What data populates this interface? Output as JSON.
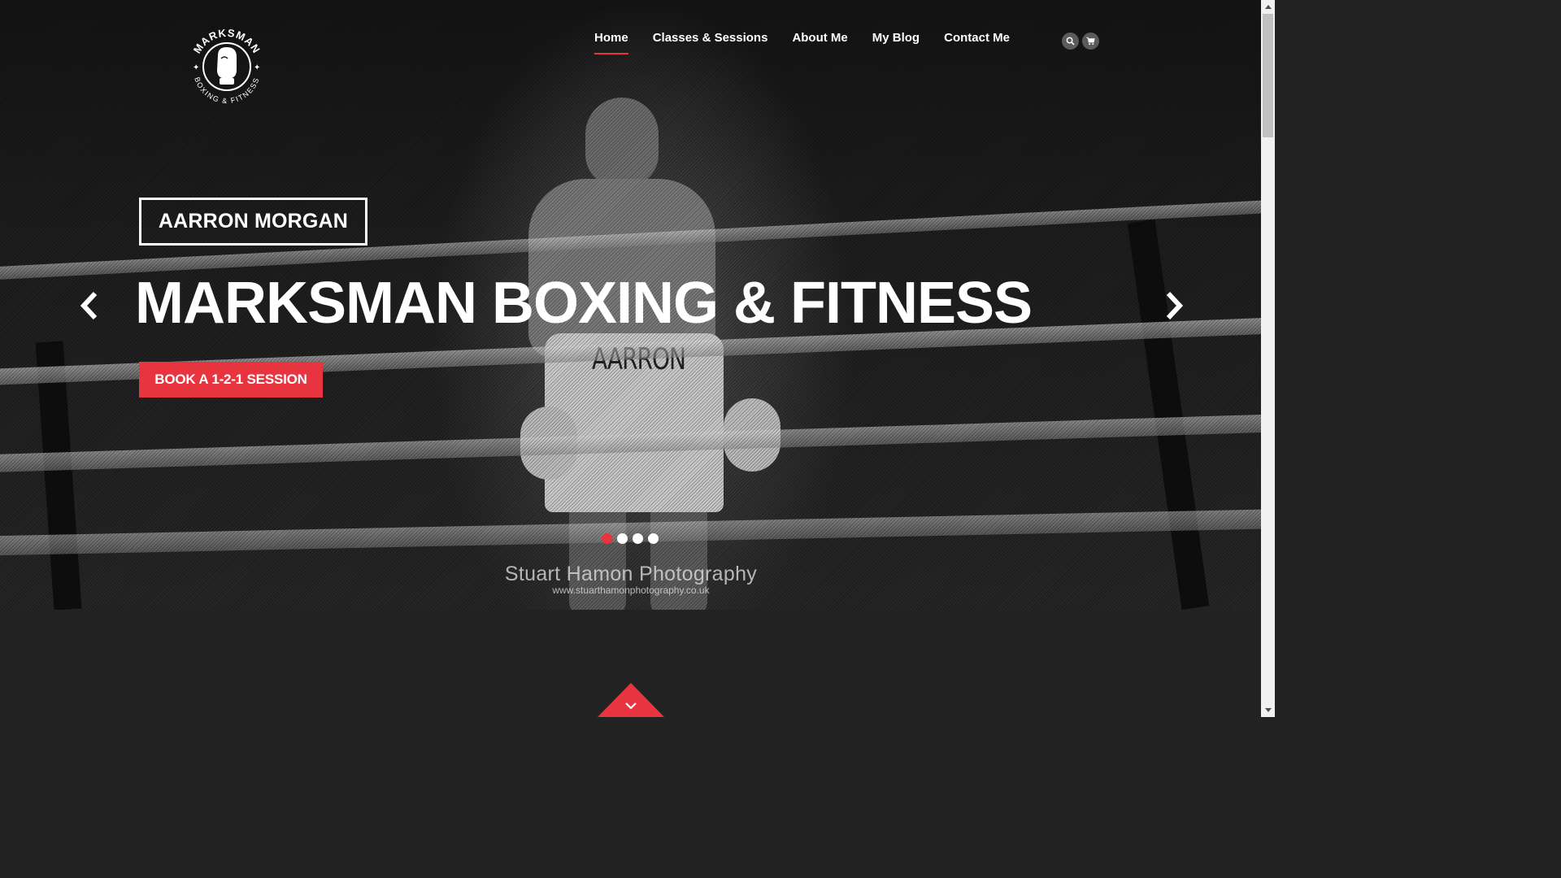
{
  "brand": {
    "logo_top_text": "MARKSMAN",
    "logo_bottom_text": "BOXING & FITNESS"
  },
  "nav": {
    "items": [
      {
        "label": "Home",
        "active": true
      },
      {
        "label": "Classes & Sessions",
        "active": false
      },
      {
        "label": "About Me",
        "active": false
      },
      {
        "label": "My Blog",
        "active": false
      },
      {
        "label": "Contact Me",
        "active": false
      }
    ],
    "icons": [
      "search-icon",
      "cart-icon"
    ]
  },
  "hero": {
    "name_label": "AARRON MORGAN",
    "headline": "MARKSMAN BOXING & FITNESS",
    "cta_label": "BOOK A 1-2-1 SESSION",
    "photo_shorts_text": "AARRON",
    "slides_count": 4,
    "active_slide": 1,
    "watermark_line1": "Stuart Hamon Photography",
    "watermark_line2": "www.stuarthamonphotography.co.uk"
  },
  "colors": {
    "accent": "#e8343f",
    "background_dark": "#222222",
    "text": "#ffffff"
  }
}
